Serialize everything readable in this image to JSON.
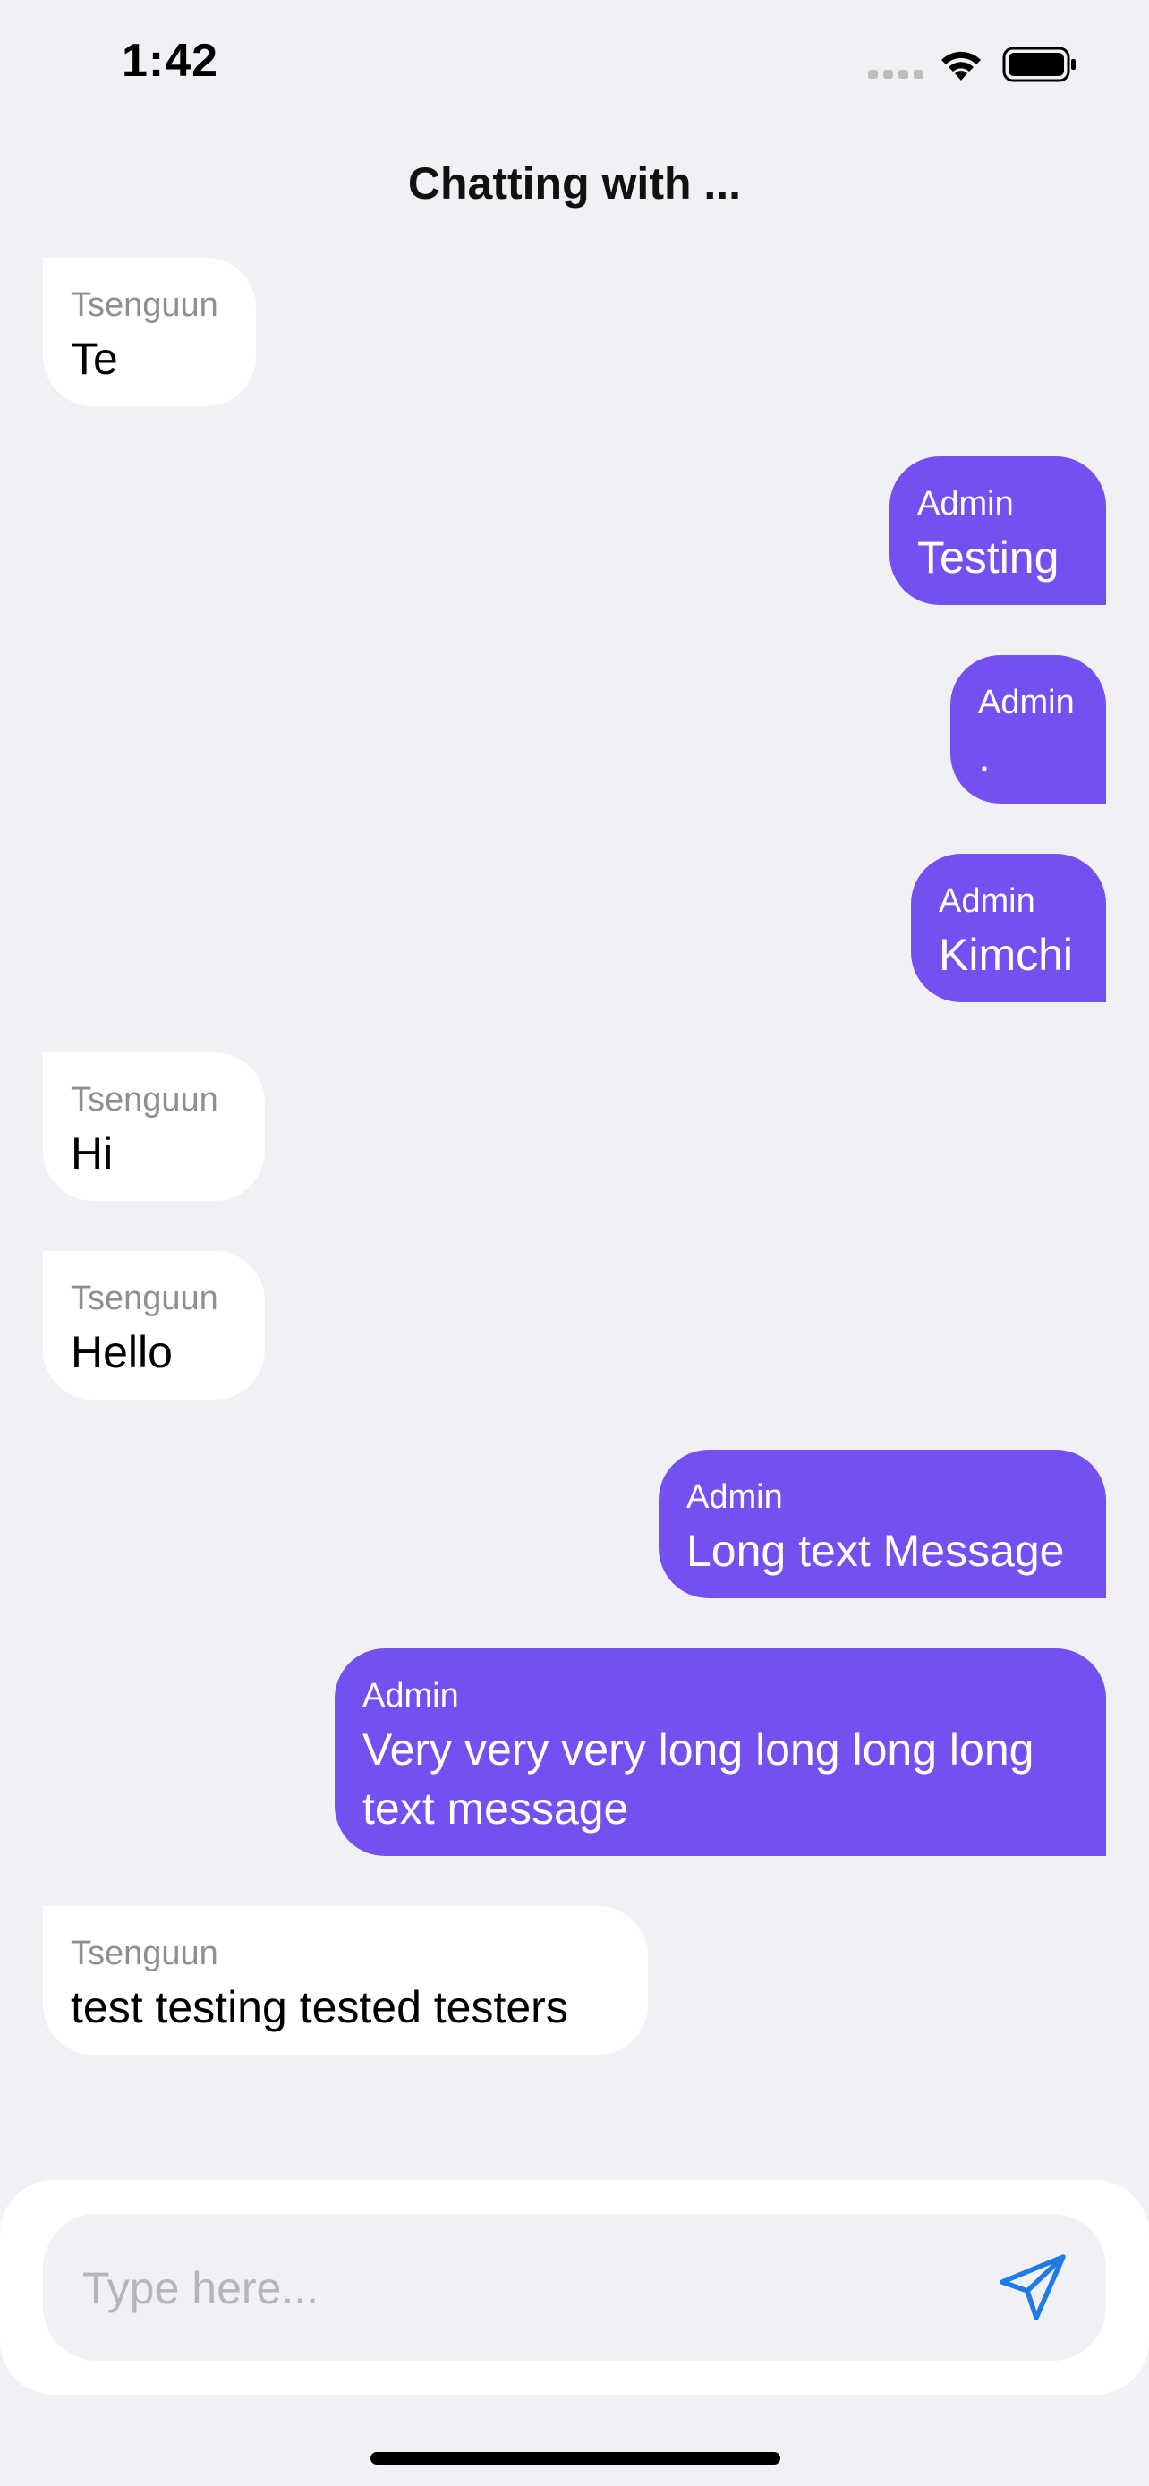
{
  "status_bar": {
    "time": "1:42"
  },
  "header": {
    "title": "Chatting with ..."
  },
  "messages": [
    {
      "sender": "Tsenguun",
      "text": "Te",
      "direction": "incoming"
    },
    {
      "sender": "Admin",
      "text": "Testing",
      "direction": "outgoing"
    },
    {
      "sender": "Admin",
      "text": ".",
      "direction": "outgoing"
    },
    {
      "sender": "Admin",
      "text": "Kimchi",
      "direction": "outgoing"
    },
    {
      "sender": "Tsenguun",
      "text": "Hi",
      "direction": "incoming"
    },
    {
      "sender": "Tsenguun",
      "text": "Hello",
      "direction": "incoming"
    },
    {
      "sender": "Admin",
      "text": "Long text Message",
      "direction": "outgoing"
    },
    {
      "sender": "Admin",
      "text": "Very very very long long long long text message",
      "direction": "outgoing"
    },
    {
      "sender": "Tsenguun",
      "text": "test testing tested testers",
      "direction": "incoming"
    }
  ],
  "composer": {
    "placeholder": "Type here...",
    "value": "",
    "send_icon": "send-icon"
  },
  "colors": {
    "background": "#F0F1F4",
    "incoming_bubble": "#FFFFFF",
    "outgoing_bubble": "#7550F0",
    "send_icon": "#1E7BE6"
  }
}
